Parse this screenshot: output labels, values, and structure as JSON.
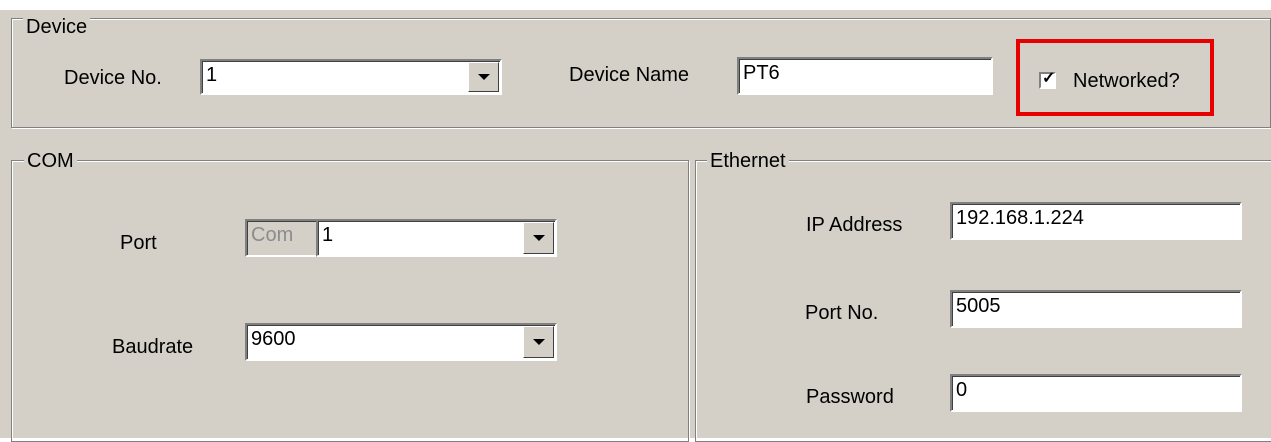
{
  "device": {
    "legend": "Device",
    "device_no_label": "Device No.",
    "device_no_value": "1",
    "device_name_label": "Device Name",
    "device_name_value": "PT6",
    "networked_label": "Networked?",
    "networked_checked": true
  },
  "com": {
    "legend": "COM",
    "port_label": "Port",
    "port_prefix": "Com",
    "port_value": "1",
    "baudrate_label": "Baudrate",
    "baudrate_value": "9600"
  },
  "ethernet": {
    "legend": "Ethernet",
    "ip_label": "IP Address",
    "ip_value": "192.168.1.224",
    "port_label": "Port No.",
    "port_value": "5005",
    "password_label": "Password",
    "password_value": "0"
  },
  "colors": {
    "background": "#d4d0c8",
    "highlight": "#e60000"
  },
  "icons": {
    "dropdown": "chevron-down-icon",
    "check": "checkmark-icon"
  }
}
